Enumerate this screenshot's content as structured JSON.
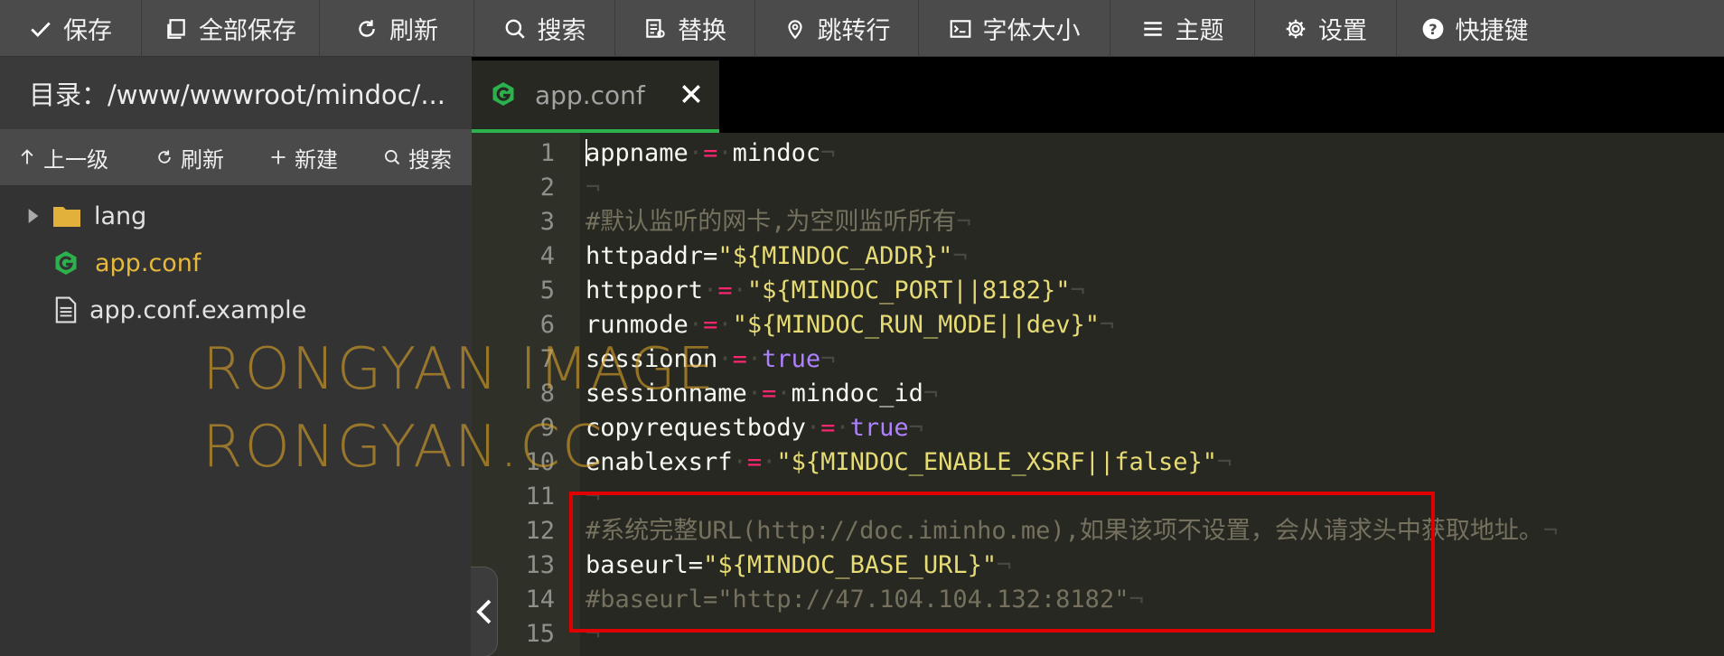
{
  "toolbar": {
    "items": [
      {
        "label": "保存",
        "icon": "check-icon"
      },
      {
        "label": "全部保存",
        "icon": "copy-icon"
      },
      {
        "label": "刷新",
        "icon": "refresh-icon"
      },
      {
        "label": "搜索",
        "icon": "search-icon"
      },
      {
        "label": "替换",
        "icon": "replace-icon"
      },
      {
        "label": "跳转行",
        "icon": "location-icon"
      },
      {
        "label": "字体大小",
        "icon": "terminal-icon"
      },
      {
        "label": "主题",
        "icon": "menu-icon"
      },
      {
        "label": "设置",
        "icon": "gear-icon"
      },
      {
        "label": "快捷键",
        "icon": "help-icon"
      }
    ]
  },
  "sidebar": {
    "directory": "目录：/www/wwwroot/mindoc/...",
    "actions": [
      {
        "label": "上一级",
        "icon": "arrow-up-icon"
      },
      {
        "label": "刷新",
        "icon": "refresh-icon"
      },
      {
        "label": "新建",
        "icon": "plus-icon"
      },
      {
        "label": "搜索",
        "icon": "search-icon"
      }
    ],
    "tree": [
      {
        "label": "lang",
        "type": "folder"
      },
      {
        "label": "app.conf",
        "type": "go-file",
        "active": true
      },
      {
        "label": "app.conf.example",
        "type": "file"
      }
    ]
  },
  "editor": {
    "tab": {
      "label": "app.conf"
    },
    "line_numbers": [
      "1",
      "2",
      "3",
      "4",
      "5",
      "6",
      "7",
      "8",
      "9",
      "10",
      "11",
      "12",
      "13",
      "14",
      "15"
    ],
    "lines": {
      "l1": {
        "key": "appname",
        "op": "=",
        "val": "mindoc"
      },
      "l3": {
        "comment": "#默认监听的网卡,为空则监听所有"
      },
      "l4": {
        "key": "httpaddr",
        "op": "=",
        "val": "\"${MINDOC_ADDR}\""
      },
      "l5": {
        "key": "httpport",
        "op": "=",
        "val": "\"${MINDOC_PORT||8182}\""
      },
      "l6": {
        "key": "runmode",
        "op": "=",
        "val": "\"${MINDOC_RUN_MODE||dev}\""
      },
      "l7": {
        "key": "sessionon",
        "op": "=",
        "val": "true"
      },
      "l8": {
        "key": "sessionname",
        "op": "=",
        "val": "mindoc_id"
      },
      "l9": {
        "key": "copyrequestbody",
        "op": "=",
        "val": "true"
      },
      "l10": {
        "key": "enablexsrf",
        "op": "=",
        "val": "\"${MINDOC_ENABLE_XSRF||false}\""
      },
      "l12": {
        "comment": "#系统完整URL(http://doc.iminho.me),如果该项不设置，会从请求头中获取地址。"
      },
      "l13": {
        "key": "baseurl",
        "op": "=",
        "val": "\"${MINDOC_BASE_URL}\""
      },
      "l14": {
        "comment": "#baseurl=\"http://47.104.104.132:8182\""
      }
    },
    "eol_marker": "¬",
    "space_marker": "·"
  },
  "watermark": {
    "line1": "RONGYAN IMAGE",
    "line2": "RONGYAN.CC"
  },
  "colors": {
    "accent_green": "#2bb24c",
    "active_file": "#e6b93c",
    "keyword": "#f92672",
    "string": "#e6db74",
    "boolean": "#ae81ff",
    "comment": "#75715e",
    "highlight_box": "#e00000"
  }
}
